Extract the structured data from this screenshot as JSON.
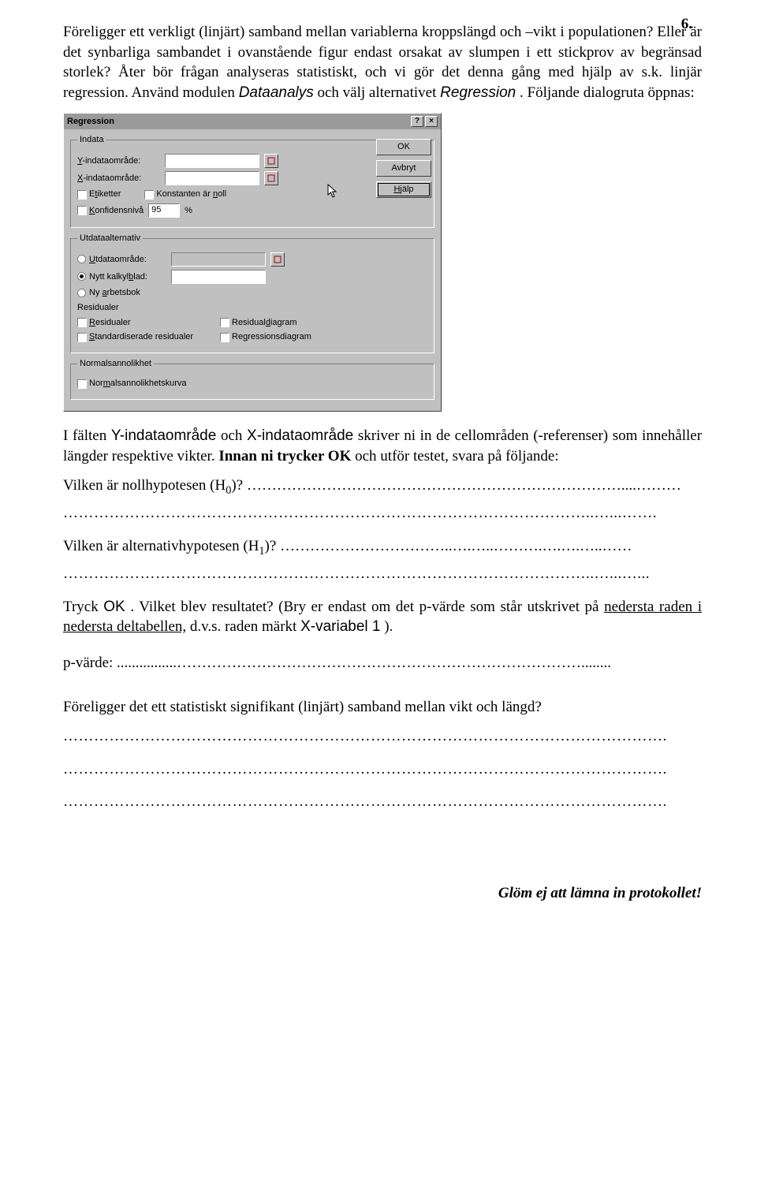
{
  "page_number": "6.",
  "paragraphs": {
    "p1a": "Föreligger ett verkligt (linjärt) samband mellan variablerna kroppslängd och –vikt i populationen? Eller är det synbarliga sambandet i ovanstående figur endast orsakat av slumpen i ett stickprov av begränsad storlek? Åter bör frågan analyseras statistiskt, och vi gör det denna gång med hjälp av s.k. linjär regression. Använd modulen ",
    "p1b": " och välj alternativet ",
    "p1c": ". Följande dialogruta öppnas:",
    "module_name": "Dataanalys",
    "alt_name": "Regression",
    "p2a": "I fälten ",
    "p2b": " och ",
    "p2c": " skriver ni in de cellområden (-referenser) som innehåller längder respektive vikter. ",
    "p2bold": "Innan ni trycker OK",
    "p2d": " och utför testet, svara på följande:",
    "field_y": "Y-indataområde",
    "field_x": "X-indataområde",
    "q1": "Vilken är nollhypotesen (H",
    "q1sub": "0",
    "q1tail": ")? …………………………………………………………………....………",
    "q1line2": "…………………………………………………………………………………………..…...…….",
    "q2": "Vilken är alternativhypotesen (H",
    "q2sub": "1",
    "q2tail": ")? ……………………………..….…..……….….….…..……",
    "q2line2": "…………………………………………………………………………………………..…...…...",
    "p3a": "Tryck ",
    "p3ok": "OK",
    "p3b": ". Vilket blev resultatet? (Bry er endast om det p-värde som står utskrivet på ",
    "p3u": "nedersta raden i nedersta deltabellen,",
    "p3c": " d.v.s. raden märkt ",
    "p3var": "X-variabel 1",
    "p3d": ").",
    "p4": "p-värde:  ................………………………………………………………………………........",
    "p5": "Föreligger det ett statistiskt signifikant (linjärt) samband mellan vikt och längd?",
    "p5line": "……………………………………………………………………………………………………….",
    "footer": "Glöm ej att lämna in protokollet!"
  },
  "dialog": {
    "title": "Regression",
    "ok": "OK",
    "cancel": "Avbryt",
    "help": "Hjälp",
    "grp_indata": "Indata",
    "y_label": "Y-indataområde:",
    "x_label": "X-indataområde:",
    "cb_labels": "Etiketter",
    "cb_const": "Konstanten är noll",
    "cb_conf": "Konfidensnivå",
    "conf_val": "95",
    "pct": "%",
    "grp_out": "Utdataalternativ",
    "rb_out": "Utdataområde:",
    "rb_sheet": "Nytt kalkylblad:",
    "rb_book": "Ny arbetsbok",
    "grp_res": "Residualer",
    "cb_res": "Residualer",
    "cb_std": "Standardiserade residualer",
    "cb_resdiag": "Residualdiagram",
    "cb_regdiag": "Regressionsdiagram",
    "grp_norm": "Normalsannolikhet",
    "cb_norm": "Normalsannolikhetskurva"
  }
}
